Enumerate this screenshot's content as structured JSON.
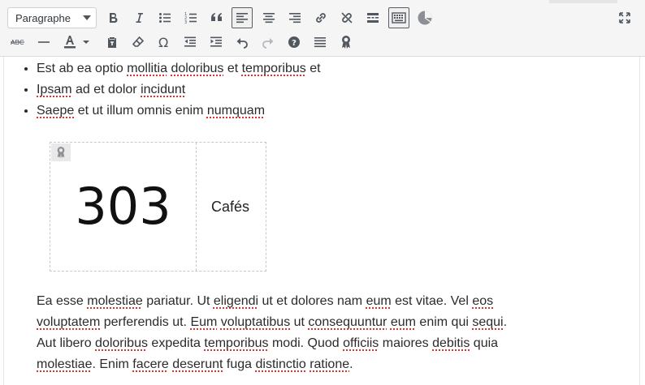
{
  "toolbar": {
    "format_select": {
      "value": "Paragraphe"
    },
    "row1": [
      {
        "name": "bold-button",
        "icon": "bold-icon"
      },
      {
        "name": "italic-button",
        "icon": "italic-icon"
      },
      {
        "name": "bullet-list-button",
        "icon": "bullet-list-icon"
      },
      {
        "name": "numbered-list-button",
        "icon": "numbered-list-icon"
      },
      {
        "name": "blockquote-button",
        "icon": "blockquote-icon"
      },
      {
        "name": "align-left-button",
        "icon": "align-left-icon",
        "active": true
      },
      {
        "name": "align-center-button",
        "icon": "align-center-icon"
      },
      {
        "name": "align-right-button",
        "icon": "align-right-icon"
      },
      {
        "name": "insert-link-button",
        "icon": "link-icon"
      },
      {
        "name": "remove-link-button",
        "icon": "unlink-icon"
      },
      {
        "name": "read-more-button",
        "icon": "read-more-icon"
      },
      {
        "name": "toolbar-toggle-button",
        "icon": "keyboard-icon",
        "active": true
      },
      {
        "name": "chart-button",
        "icon": "pie-chart-icon"
      }
    ],
    "row2": [
      {
        "name": "strikethrough-button",
        "icon": "strikethrough-icon"
      },
      {
        "name": "horizontal-line-button",
        "icon": "horizontal-line-icon"
      },
      {
        "name": "text-color-button",
        "icon": "text-color-icon"
      },
      {
        "name": "text-color-dropdown",
        "icon": "chevron-down-icon"
      },
      {
        "name": "paste-text-button",
        "icon": "paste-icon"
      },
      {
        "name": "clear-formatting-button",
        "icon": "eraser-icon"
      },
      {
        "name": "special-character-button",
        "icon": "omega-icon"
      },
      {
        "name": "outdent-button",
        "icon": "outdent-icon"
      },
      {
        "name": "indent-button",
        "icon": "indent-icon"
      },
      {
        "name": "undo-button",
        "icon": "undo-icon"
      },
      {
        "name": "redo-button",
        "icon": "redo-icon",
        "disabled": true
      },
      {
        "name": "help-button",
        "icon": "help-icon"
      },
      {
        "name": "list-widget-button",
        "icon": "list-icon"
      },
      {
        "name": "award-widget-button",
        "icon": "award-icon"
      }
    ],
    "fullscreen_icon": "fullscreen-icon"
  },
  "content": {
    "list": [
      [
        {
          "t": "Est ab ea optio "
        },
        {
          "t": "mollitia",
          "s": true
        },
        {
          "t": " "
        },
        {
          "t": "doloribus",
          "s": true
        },
        {
          "t": " et "
        },
        {
          "t": "temporibus",
          "s": true
        },
        {
          "t": " et"
        }
      ],
      [
        {
          "t": "Ipsam",
          "s": true
        },
        {
          "t": " ad et dolor "
        },
        {
          "t": "incidunt",
          "s": true
        }
      ],
      [
        {
          "t": "Saepe",
          "s": true
        },
        {
          "t": " et ut illum omnis enim "
        },
        {
          "t": "numquam",
          "s": true
        }
      ]
    ],
    "counter": {
      "number": "303",
      "label": "Cafés",
      "badge_icon": "award-icon"
    },
    "paragraph": [
      {
        "t": "Ea esse "
      },
      {
        "t": "molestiae",
        "s": true
      },
      {
        "t": " pariatur. Ut "
      },
      {
        "t": "eligendi",
        "s": true
      },
      {
        "t": " ut et dolores nam "
      },
      {
        "t": "eum",
        "s": true
      },
      {
        "t": " est vitae. Vel "
      },
      {
        "t": "eos",
        "s": true
      },
      {
        "t": " "
      },
      {
        "t": "voluptatem",
        "s": true
      },
      {
        "t": " perferendis ut. "
      },
      {
        "t": "Eum",
        "s": true
      },
      {
        "t": " "
      },
      {
        "t": "voluptatibus",
        "s": true
      },
      {
        "t": " ut "
      },
      {
        "t": "consequuntur",
        "s": true
      },
      {
        "t": " "
      },
      {
        "t": "eum",
        "s": true
      },
      {
        "t": " enim qui "
      },
      {
        "t": "sequi",
        "s": true
      },
      {
        "t": ". Aut libero "
      },
      {
        "t": "doloribus",
        "s": true
      },
      {
        "t": " expedita "
      },
      {
        "t": "temporibus",
        "s": true
      },
      {
        "t": " modi. Quod "
      },
      {
        "t": "officiis",
        "s": true
      },
      {
        "t": " maiores "
      },
      {
        "t": "debitis",
        "s": true
      },
      {
        "t": " quia "
      },
      {
        "t": "molestiae",
        "s": true
      },
      {
        "t": ". Enim "
      },
      {
        "t": "facere",
        "s": true
      },
      {
        "t": " "
      },
      {
        "t": "deserunt",
        "s": true
      },
      {
        "t": " fuga "
      },
      {
        "t": "distinctio",
        "s": true
      },
      {
        "t": " "
      },
      {
        "t": "ratione",
        "s": true
      },
      {
        "t": "."
      }
    ]
  },
  "colors": {
    "icon": "#50575e",
    "icon_disabled": "#b4b9be",
    "spellcheck": "#dc3232",
    "toolbar_bg": "#f5f5f5"
  }
}
